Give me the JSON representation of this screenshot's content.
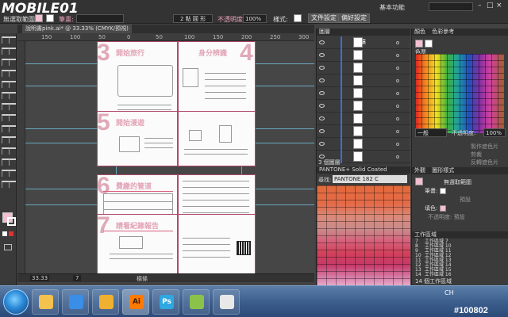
{
  "app": {
    "logo_text": "MOBILE01",
    "doc_tab": "說明書pink.ai* @ 33.33% (CMYK/預視)",
    "colors": {
      "accent_pink": "#e3a4b7",
      "guide": "#6fb9d6",
      "page_border": "#b04a6a"
    }
  },
  "control_bar": {
    "selection_label": "無選取範圍",
    "stroke_label": "筆畫:",
    "brush_label": "2 點 圓 形",
    "opacity_label": "不透明度:",
    "opacity_value": "100%",
    "style_label": "樣式:",
    "doc_setup_button": "文件設定",
    "prefs_button": "偏好設定",
    "workspace": "基本功能",
    "search_placeholder": ""
  },
  "rulers": {
    "h_marks": [
      "150",
      "100",
      "50",
      "0",
      "50",
      "100",
      "150",
      "200",
      "250",
      "300"
    ]
  },
  "document": {
    "spreads": [
      {
        "num_left": "3",
        "title_left": "開始旅行",
        "num_right": "4",
        "title_right": "身分辨識"
      },
      {
        "num_left": "5",
        "title_left": "開始漫遊",
        "num_right": "",
        "title_right": ""
      },
      {
        "num_left": "6",
        "title_left": "費繳的管道",
        "num_right": "",
        "title_right": ""
      },
      {
        "num_left": "7",
        "title_left": "請看紀錄報告",
        "num_right": "",
        "title_right": ""
      }
    ]
  },
  "status_bar": {
    "zoom": "33.33",
    "page": "7",
    "mode": "橫條"
  },
  "layers_panel": {
    "tabs": [
      "圖層"
    ],
    "top_layer": "白墳",
    "rows": 10,
    "footer": "3 個圖層"
  },
  "pantone_panel": {
    "title": "PANTONE+ Solid Coated",
    "search_label": "尋找:",
    "search_value": "PANTONE 182 C"
  },
  "right_panel": {
    "tabs_top": [
      "顏色",
      "色彩參考"
    ],
    "swatches_tab": "色票",
    "blend_mode": "一般",
    "opacity_label": "不透明度:",
    "opacity_value": "100%",
    "mask_button": "製作遮色片",
    "clip_label": "剪裁",
    "invert_label": "反轉遮色片",
    "appearance_tabs": [
      "外觀",
      "圖形樣式"
    ],
    "appearance_title": "無選取範圍",
    "stroke_item": "筆畫:",
    "stroke_value": "預設",
    "fill_item": "填色:",
    "opacity_item": "不透明度: 預設",
    "artboards_title": "工作區域",
    "artboards": [
      {
        "num": "7",
        "name": "工作區域 7"
      },
      {
        "num": "8",
        "name": "工作區域 10"
      },
      {
        "num": "9",
        "name": "工作區域 11"
      },
      {
        "num": "10",
        "name": "工作區域 12"
      },
      {
        "num": "11",
        "name": "工作區域 13"
      },
      {
        "num": "12",
        "name": "工作區域 14"
      },
      {
        "num": "13",
        "name": "工作區域 15"
      },
      {
        "num": "14",
        "name": "工作區域 16"
      }
    ],
    "artboard_footer": "14 個工作區域"
  },
  "taskbar": {
    "clock_label": "CH",
    "apps": [
      "explorer",
      "media",
      "folder",
      "illustrator",
      "photoshop",
      "camera",
      "browser"
    ]
  },
  "watermark": "#100802"
}
